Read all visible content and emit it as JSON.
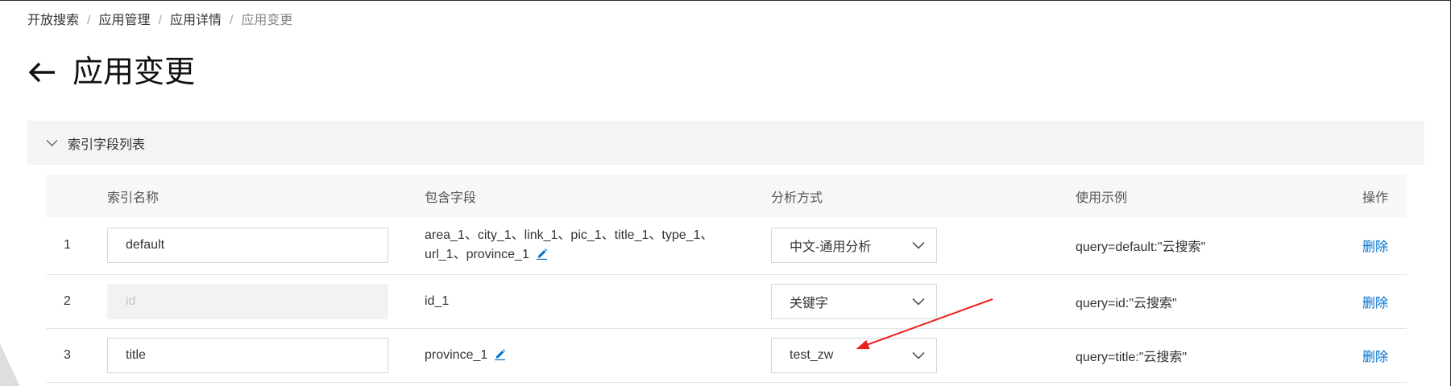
{
  "breadcrumb": {
    "separator": "/",
    "items": [
      {
        "label": "开放搜索"
      },
      {
        "label": "应用管理"
      },
      {
        "label": "应用详情"
      },
      {
        "label": "应用变更",
        "current": true
      }
    ]
  },
  "header": {
    "back_icon": "arrow-left-icon",
    "title": "应用变更"
  },
  "panel": {
    "toggle_icon": "chevron-down-icon",
    "expanded": true,
    "title": "索引字段列表"
  },
  "table": {
    "edit_icon": "pencil-icon",
    "select_icon": "chevron-down-icon",
    "columns": {
      "name": "索引名称",
      "fields": "包含字段",
      "analyzer": "分析方式",
      "example": "使用示例",
      "action": "操作"
    },
    "rows": [
      {
        "index": "1",
        "name": "default",
        "name_disabled": false,
        "fields_lines": [
          "area_1、city_1、link_1、pic_1、title_1、type_1、",
          "url_1、province_1"
        ],
        "fields_editable": true,
        "analyzer": "中文-通用分析",
        "example": "query=default:\"云搜索\"",
        "action": "删除"
      },
      {
        "index": "2",
        "name": "id",
        "name_disabled": true,
        "fields_lines": [
          "id_1"
        ],
        "fields_editable": false,
        "analyzer": "关键字",
        "example": "query=id:\"云搜索\"",
        "action": "删除"
      },
      {
        "index": "3",
        "name": "title",
        "name_disabled": false,
        "fields_lines": [
          "province_1"
        ],
        "fields_editable": true,
        "analyzer": "test_zw",
        "example": "query=title:\"云搜索\"",
        "action": "删除"
      }
    ]
  },
  "annotation": {
    "icon": "red-arrow-icon"
  },
  "theme": {
    "text": "#333333",
    "muted": "#888888",
    "link": "#0070cc",
    "panel_bg": "#f4f4f4",
    "table_header_bg": "#f7f7f7",
    "input_border": "#d6d6d6",
    "annotation_red": "#e8231f"
  }
}
